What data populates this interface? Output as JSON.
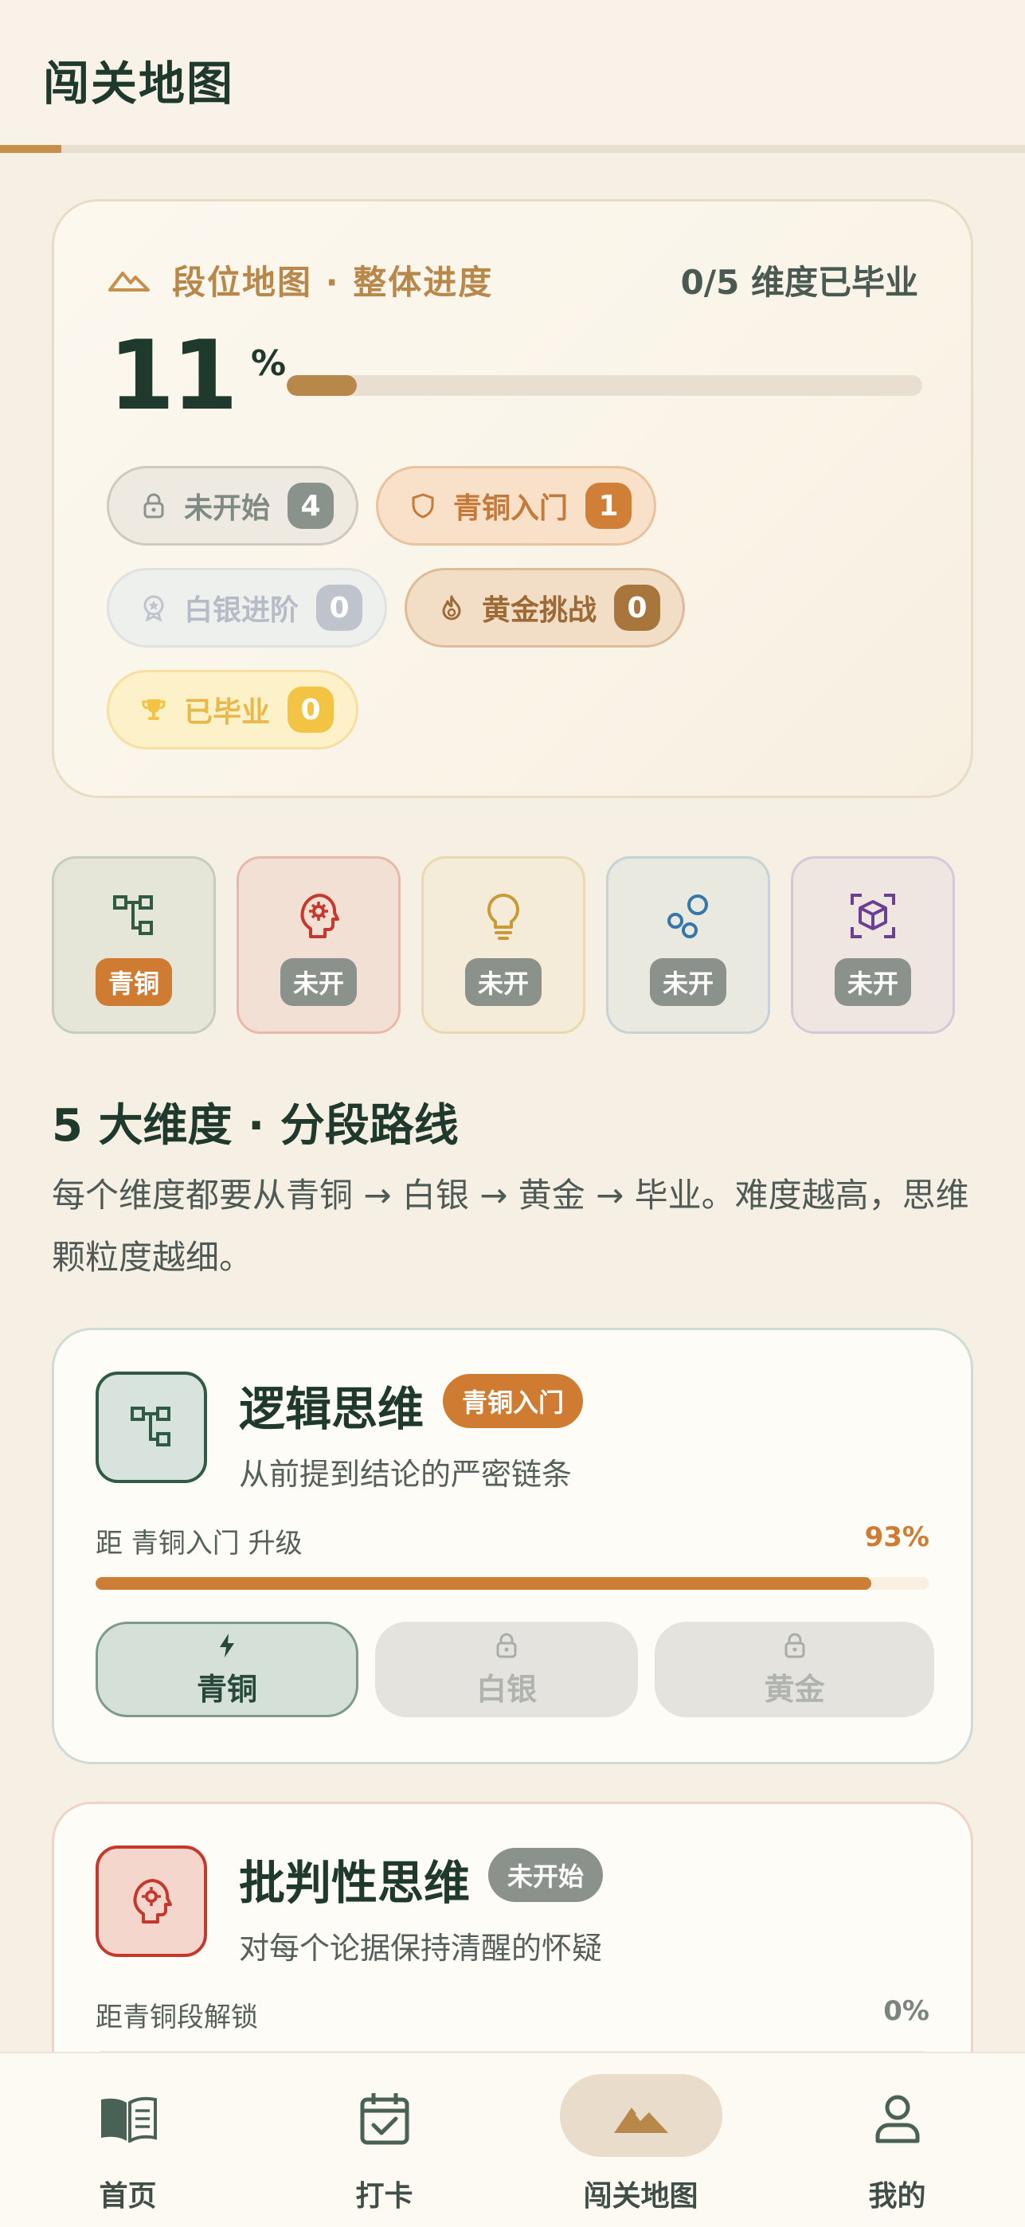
{
  "header": {
    "title": "闯关地图",
    "progress_fraction": 0.06
  },
  "overview": {
    "title": "段位地图 · 整体进度",
    "graduated_summary": "0/5 维度已毕业",
    "percent": "11",
    "percent_symbol": "%",
    "progress_fraction": 0.11,
    "chips": [
      {
        "label": "未开始",
        "count": "4",
        "icon": "lock-icon"
      },
      {
        "label": "青铜入门",
        "count": "1",
        "icon": "shield-icon"
      },
      {
        "label": "白银进阶",
        "count": "0",
        "icon": "badge-icon"
      },
      {
        "label": "黄金挑战",
        "count": "0",
        "icon": "flame-icon"
      },
      {
        "label": "已毕业",
        "count": "0",
        "icon": "trophy-icon"
      }
    ]
  },
  "dimension_tiles": [
    {
      "badge": "青铜",
      "icon": "hierarchy-icon",
      "badge_color": "#cf7c32"
    },
    {
      "badge": "未开",
      "icon": "brain-gear-icon",
      "badge_color": "#8b928c"
    },
    {
      "badge": "未开",
      "icon": "lightbulb-icon",
      "badge_color": "#8b928c"
    },
    {
      "badge": "未开",
      "icon": "bubbles-icon",
      "badge_color": "#8b928c"
    },
    {
      "badge": "未开",
      "icon": "cube-focus-icon",
      "badge_color": "#8b928c"
    }
  ],
  "section": {
    "title": "5 大维度 · 分段路线",
    "description": "每个维度都要从青铜 → 白银 → 黄金 → 毕业。难度越高，思维颗粒度越细。"
  },
  "cards": [
    {
      "name": "逻辑思维",
      "tag": "青铜入门",
      "subtitle": "从前提到结论的严密链条",
      "progress_label": "距 青铜入门 升级",
      "progress_value": "93%",
      "progress_fraction": 0.93,
      "stages": [
        {
          "label": "青铜",
          "icon": "bolt-icon"
        },
        {
          "label": "白银",
          "icon": "lock-icon"
        },
        {
          "label": "黄金",
          "icon": "lock-icon"
        }
      ]
    },
    {
      "name": "批判性思维",
      "tag": "未开始",
      "subtitle": "对每个论据保持清醒的怀疑",
      "progress_label": "距青铜段解锁",
      "progress_value": "0%",
      "progress_fraction": 0
    }
  ],
  "nav": [
    {
      "label": "首页",
      "icon": "book-icon"
    },
    {
      "label": "打卡",
      "icon": "calendar-check-icon"
    },
    {
      "label": "闯关地图",
      "icon": "mountain-icon",
      "active": true
    },
    {
      "label": "我的",
      "icon": "user-icon"
    }
  ],
  "colors": {
    "background": "#f6f0e4",
    "primary_text": "#1f3a2c",
    "bronze": "#cf7c32",
    "accent_gold": "#b8884a"
  }
}
